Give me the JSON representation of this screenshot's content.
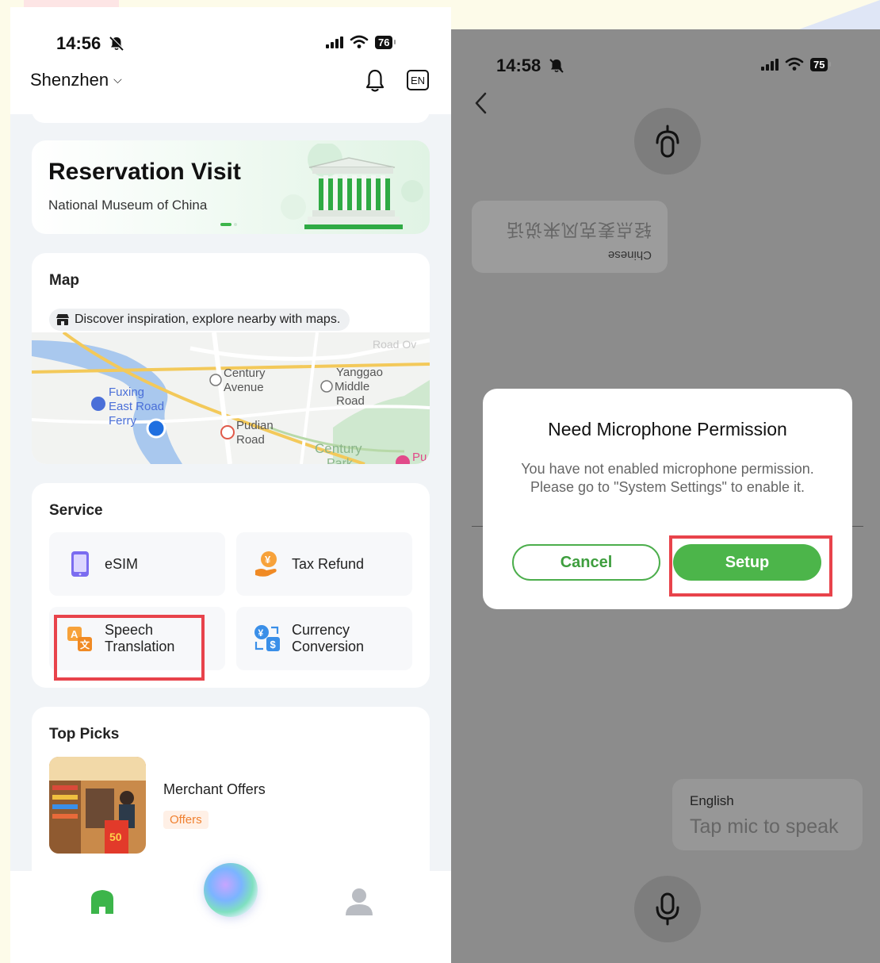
{
  "left_screen": {
    "status_bar": {
      "time": "14:56",
      "battery": "76"
    },
    "header": {
      "city": "Shenzhen",
      "language_button": "EN"
    },
    "banner": {
      "title": "Reservation Visit",
      "subtitle": "National Museum of China"
    },
    "map_card": {
      "title": "Map",
      "hint": "Discover inspiration, explore nearby with maps.",
      "labels": {
        "road_top": "Road Ov",
        "century_avenue_1": "Century",
        "century_avenue_2": "Avenue",
        "yanggao_1": "Yanggao",
        "yanggao_2": "Middle",
        "yanggao_3": "Road",
        "fuxing_1": "Fuxing",
        "fuxing_2": "East Road",
        "fuxing_3": "Ferry",
        "pudian_1": "Pudian",
        "pudian_2": "Road",
        "century_park_1": "Century",
        "century_park_2": "Park",
        "pu": "Pu"
      }
    },
    "service_card": {
      "title": "Service",
      "items": [
        {
          "label_1": "eSIM",
          "label_2": "",
          "icon": "esim-phone-icon"
        },
        {
          "label_1": "Tax Refund",
          "label_2": "",
          "icon": "tax-refund-icon"
        },
        {
          "label_1": "Speech",
          "label_2": "Translation",
          "icon": "speech-translation-icon"
        },
        {
          "label_1": "Currency",
          "label_2": "Conversion",
          "icon": "currency-conversion-icon"
        }
      ]
    },
    "top_picks": {
      "title": "Top Picks",
      "items": [
        {
          "name": "Merchant Offers",
          "badge": "Offers"
        }
      ]
    },
    "tab_bar": {
      "home_icon": "home-icon",
      "assistant_icon": "ai-orb-icon",
      "profile_icon": "profile-icon"
    }
  },
  "right_screen": {
    "status_bar": {
      "time": "14:58",
      "battery": "75"
    },
    "mirrored_bubble": {
      "language": "Chinese",
      "prompt": "轻点麦克风来说话"
    },
    "dialog": {
      "title": "Need Microphone Permission",
      "message": "You have not enabled microphone permission. Please go to \"System Settings\" to enable it.",
      "cancel_label": "Cancel",
      "setup_label": "Setup"
    },
    "english_bubble": {
      "language": "English",
      "prompt": "Tap mic to speak"
    }
  },
  "colors": {
    "accent_green": "#4cb54a",
    "highlight_red": "#e8434b",
    "overlay_gray": "#8c8c8c",
    "offers_orange": "#f08030"
  }
}
